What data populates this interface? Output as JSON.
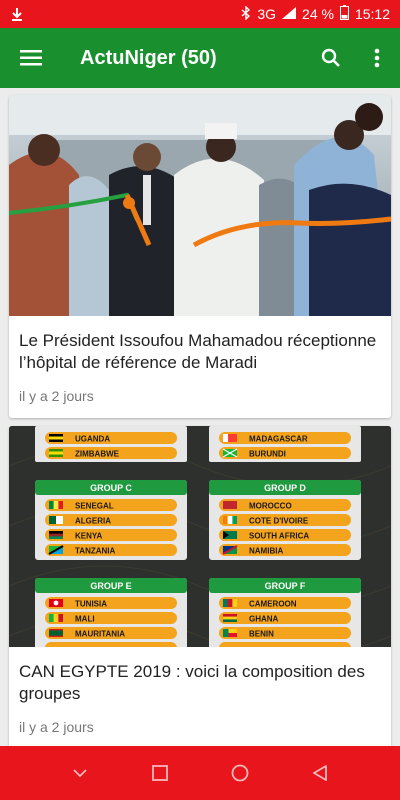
{
  "status": {
    "network": "3G",
    "battery": "24 %",
    "time": "15:12"
  },
  "app_bar": {
    "title": "ActuNiger (50)"
  },
  "articles": [
    {
      "title": "Le Président Issoufou Mahamadou réceptionne l’hôpital de référence de Maradi",
      "time": "il y a 2 jours"
    },
    {
      "title": "CAN EGYPTE 2019 : voici la composition des groupes",
      "time": "il y a 2 jours",
      "image_groups": [
        {
          "name": "",
          "teams": [
            "UGANDA",
            "ZIMBABWE"
          ]
        },
        {
          "name": "",
          "teams": [
            "MADAGASCAR",
            "BURUNDI"
          ]
        },
        {
          "name": "GROUP C",
          "teams": [
            "SENEGAL",
            "ALGERIA",
            "KENYA",
            "TANZANIA"
          ]
        },
        {
          "name": "GROUP D",
          "teams": [
            "MOROCCO",
            "COTE D'IVOIRE",
            "SOUTH AFRICA",
            "NAMIBIA"
          ]
        },
        {
          "name": "GROUP E",
          "teams": [
            "TUNISIA",
            "MALI",
            "MAURITANIA",
            ""
          ]
        },
        {
          "name": "GROUP F",
          "teams": [
            "CAMEROON",
            "GHANA",
            "BENIN",
            ""
          ]
        }
      ]
    }
  ],
  "colors": {
    "status_bar": "#e8151c",
    "app_bar": "#1a8f2e",
    "nav_bar": "#e8151c"
  }
}
